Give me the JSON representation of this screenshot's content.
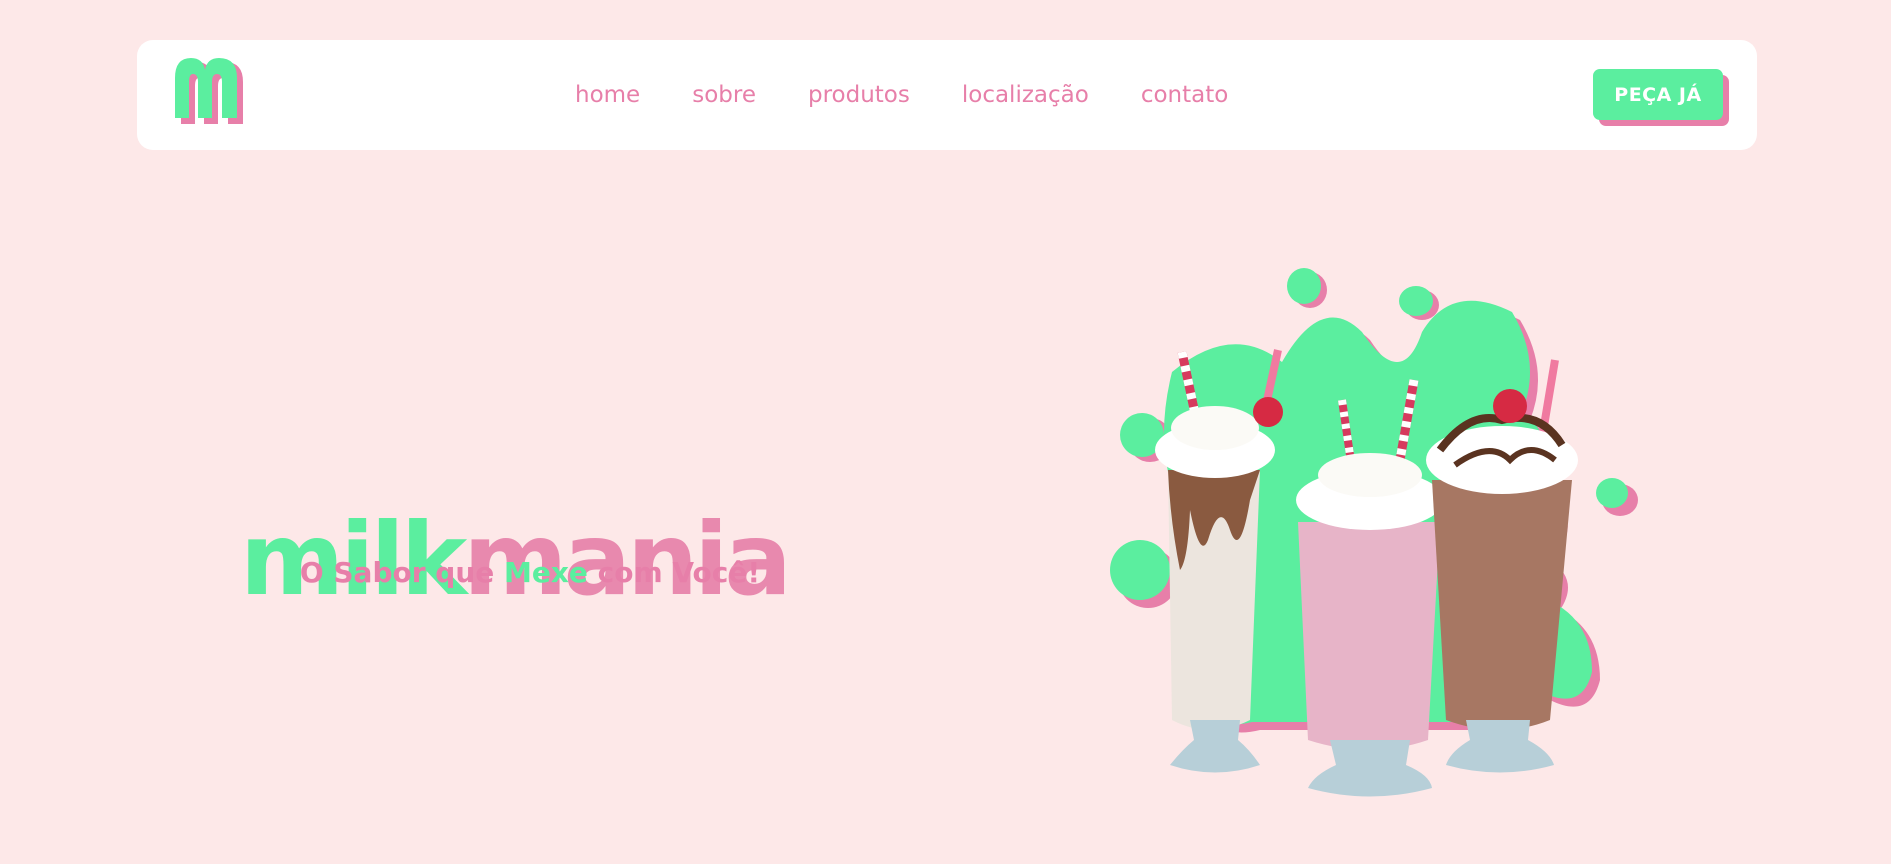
{
  "brand": {
    "logo_letter": "m",
    "title_part1": "milk",
    "title_part2": "mania",
    "tagline_pre": "O Sabor que ",
    "tagline_highlight": "Mexe",
    "tagline_post": " com Você!"
  },
  "nav": {
    "items": [
      {
        "label": "home"
      },
      {
        "label": "sobre"
      },
      {
        "label": "produtos"
      },
      {
        "label": "localização"
      },
      {
        "label": "contato"
      }
    ],
    "cta_label": "PEÇA JÁ"
  },
  "colors": {
    "background": "#fde8e8",
    "pink": "#e77fa9",
    "green": "#5bee9f",
    "white": "#ffffff"
  },
  "hero_image": {
    "icons": [
      "milkshake-chocolate-icon",
      "milkshake-strawberry-icon",
      "milkshake-mocha-icon",
      "splash-icon"
    ]
  }
}
